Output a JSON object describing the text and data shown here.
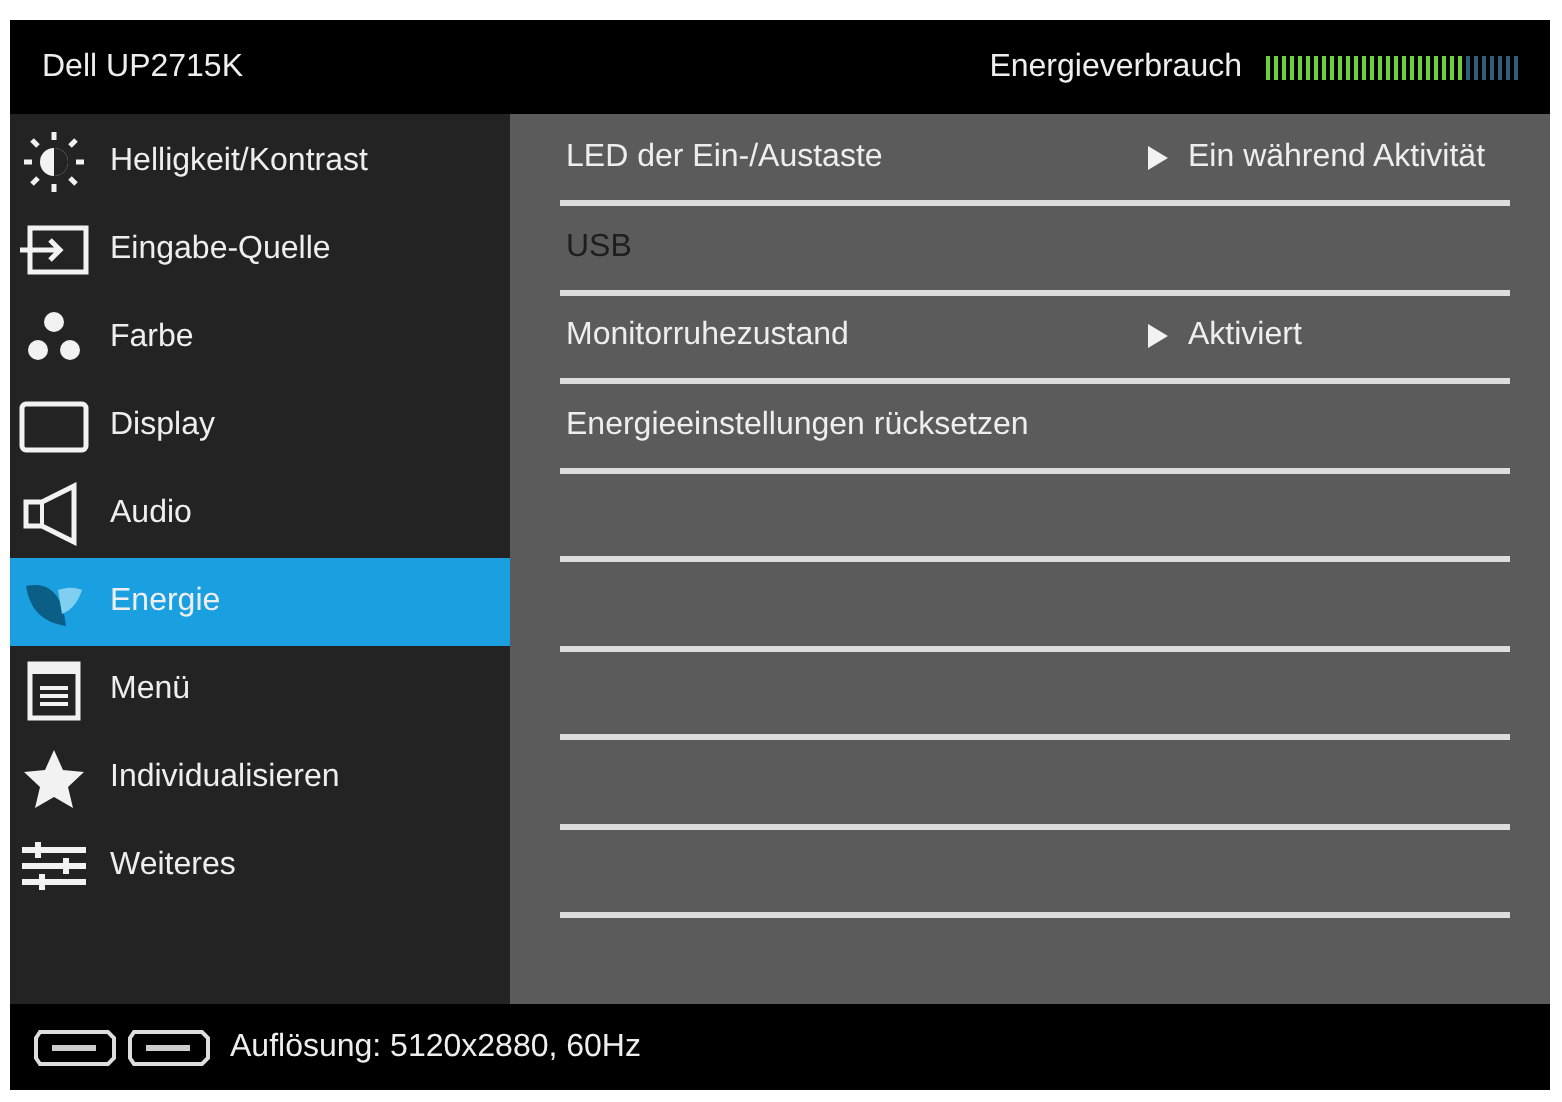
{
  "header": {
    "title": "Dell UP2715K",
    "energy_label": "Energieverbrauch"
  },
  "energy_meter": {
    "level": 0.78
  },
  "sidebar": {
    "items": [
      {
        "label": "Helligkeit/Kontrast",
        "selected": false
      },
      {
        "label": "Eingabe-Quelle",
        "selected": false
      },
      {
        "label": "Farbe",
        "selected": false
      },
      {
        "label": "Display",
        "selected": false
      },
      {
        "label": "Audio",
        "selected": false
      },
      {
        "label": "Energie",
        "selected": true
      },
      {
        "label": "Menü",
        "selected": false
      },
      {
        "label": "Individualisieren",
        "selected": false
      },
      {
        "label": "Weiteres",
        "selected": false
      }
    ]
  },
  "settings": [
    {
      "label": "LED der Ein-/Austaste",
      "value": "Ein während Aktivität",
      "disabled": false
    },
    {
      "label": "USB",
      "disabled": true
    },
    {
      "label": "Monitorruhezustand",
      "value": "Aktiviert",
      "disabled": false
    },
    {
      "label": "Energieeinstellungen rücksetzen",
      "disabled": false
    }
  ],
  "footer": {
    "resolution": "Auflösung: 5120x2880, 60Hz"
  }
}
